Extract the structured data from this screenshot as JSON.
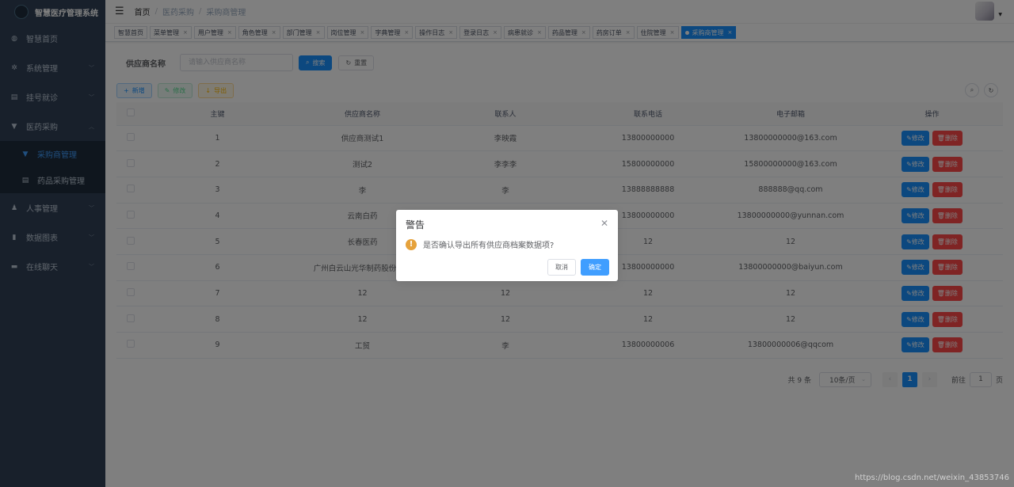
{
  "app": {
    "title": "智慧医疗管理系统"
  },
  "sidebar": {
    "items": [
      {
        "label": "智慧首页",
        "icon": "dashboard-icon",
        "glyph": "◍",
        "has_arrow": false
      },
      {
        "label": "系统管理",
        "icon": "gear-icon",
        "glyph": "✲",
        "has_arrow": true
      },
      {
        "label": "挂号就诊",
        "icon": "document-icon",
        "glyph": "▤",
        "has_arrow": true
      },
      {
        "label": "医药采购",
        "icon": "cart-icon",
        "glyph": "▼",
        "has_arrow": true,
        "expanded": true,
        "children": [
          {
            "label": "采购商管理",
            "icon": "cart-icon",
            "glyph": "▼",
            "active": true
          },
          {
            "label": "药品采购管理",
            "icon": "document-icon",
            "glyph": "▤",
            "active": false
          }
        ]
      },
      {
        "label": "人事管理",
        "icon": "people-icon",
        "glyph": "♟",
        "has_arrow": true
      },
      {
        "label": "数据图表",
        "icon": "bar-chart-icon",
        "glyph": "▮",
        "has_arrow": true
      },
      {
        "label": "在线聊天",
        "icon": "chat-icon",
        "glyph": "▬",
        "has_arrow": true
      }
    ]
  },
  "breadcrumb": [
    "首页",
    "医药采购",
    "采购商管理"
  ],
  "tags": [
    {
      "label": "智慧首页",
      "closable": false,
      "active": false
    },
    {
      "label": "菜单管理",
      "closable": true,
      "active": false
    },
    {
      "label": "用户管理",
      "closable": true,
      "active": false
    },
    {
      "label": "角色管理",
      "closable": true,
      "active": false
    },
    {
      "label": "部门管理",
      "closable": true,
      "active": false
    },
    {
      "label": "岗位管理",
      "closable": true,
      "active": false
    },
    {
      "label": "字典管理",
      "closable": true,
      "active": false
    },
    {
      "label": "操作日志",
      "closable": true,
      "active": false
    },
    {
      "label": "登录日志",
      "closable": true,
      "active": false
    },
    {
      "label": "病患就诊",
      "closable": true,
      "active": false
    },
    {
      "label": "药品管理",
      "closable": true,
      "active": false
    },
    {
      "label": "药房订单",
      "closable": true,
      "active": false
    },
    {
      "label": "住院管理",
      "closable": true,
      "active": false
    },
    {
      "label": "采购商管理",
      "closable": true,
      "active": true
    }
  ],
  "search": {
    "label": "供应商名称",
    "placeholder": "请输入供应商名称",
    "search_btn": "搜索",
    "reset_btn": "重置"
  },
  "toolbar": {
    "add": "新增",
    "edit": "修改",
    "export": "导出"
  },
  "table": {
    "columns": [
      "主键",
      "供应商名称",
      "联系人",
      "联系电话",
      "电子邮箱",
      "操作"
    ],
    "rows": [
      [
        "1",
        "供应商测试1",
        "李映霞",
        "13800000000",
        "13800000000@163.com"
      ],
      [
        "2",
        "测试2",
        "李李李",
        "15800000000",
        "15800000000@163.com"
      ],
      [
        "3",
        "李",
        "李",
        "13888888888",
        "888888@qq.com"
      ],
      [
        "4",
        "云南白药",
        "",
        "13800000000",
        "13800000000@yunnan.com"
      ],
      [
        "5",
        "长春医药",
        "",
        "12",
        "12"
      ],
      [
        "6",
        "广州白云山光华制药股份有限",
        "",
        "13800000000",
        "13800000000@baiyun.com"
      ],
      [
        "7",
        "12",
        "12",
        "12",
        "12"
      ],
      [
        "8",
        "12",
        "12",
        "12",
        "12"
      ],
      [
        "9",
        "工贸",
        "李",
        "13800000006",
        "13800000006@qqcom"
      ]
    ],
    "edit_label": "修改",
    "delete_label": "删除"
  },
  "pagination": {
    "total": "共 9 条",
    "page_size": "10条/页",
    "current": "1",
    "goto_label": "前往",
    "goto_value": "1",
    "page_unit": "页"
  },
  "dialog": {
    "title": "警告",
    "message": "是否确认导出所有供应商档案数据项?",
    "cancel": "取消",
    "confirm": "确定"
  },
  "watermark": "https://blog.csdn.net/weixin_43853746",
  "colors": {
    "sidebar": "#304156",
    "primary": "#1890ff",
    "danger": "#ff4949",
    "warning": "#e6a23c"
  }
}
